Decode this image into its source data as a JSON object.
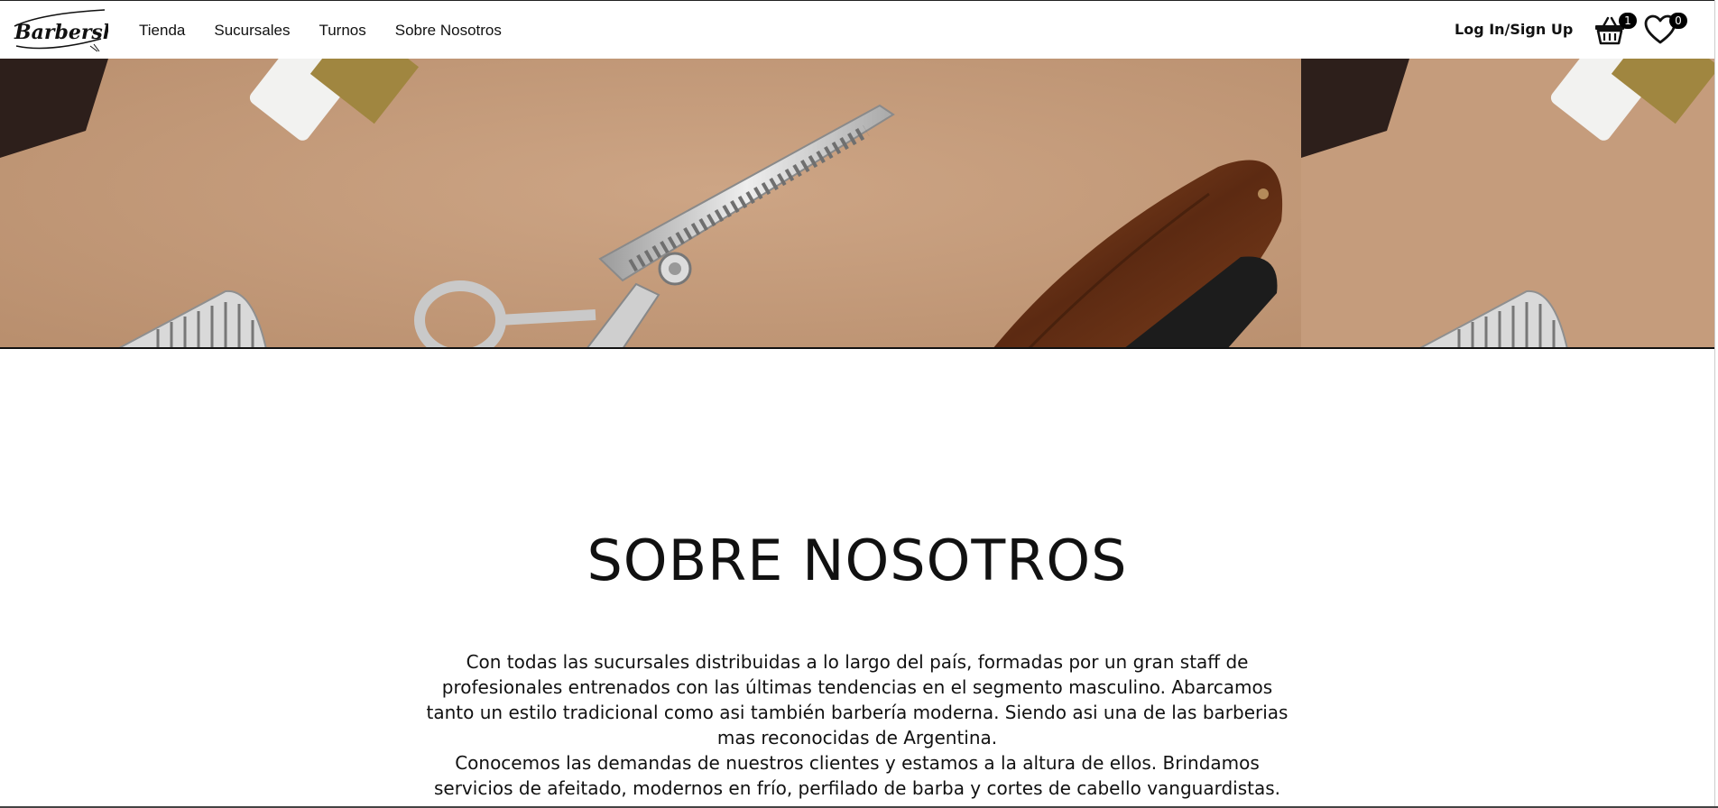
{
  "brand": {
    "logo_text": "Barbershop"
  },
  "nav": {
    "links": [
      {
        "label": "Tienda"
      },
      {
        "label": "Sucursales"
      },
      {
        "label": "Turnos"
      },
      {
        "label": "Sobre Nosotros"
      }
    ],
    "login_label": "Log In/Sign Up",
    "cart": {
      "icon": "basket-icon",
      "count": "1"
    },
    "favorites": {
      "icon": "heart-icon",
      "count": "0"
    }
  },
  "hero": {
    "background_color": "#c9a07f",
    "description_icons": [
      "scissors-icon",
      "razor-icon",
      "comb-icon",
      "bottle-icon"
    ]
  },
  "about": {
    "title": "SOBRE NOSOTROS",
    "paragraphs": [
      "Con todas las sucursales distribuidas a lo largo del país, formadas por un gran staff de profesionales entrenados con las últimas tendencias en el segmento masculino. Abarcamos tanto un estilo tradicional como asi también barbería moderna. Siendo asi una de las barberias mas reconocidas de Argentina.",
      "Conocemos las demandas de nuestros clientes y estamos a la altura de ellos. Brindamos servicios de afeitado, modernos en frío, perfilado de barba y cortes de cabello vanguardistas."
    ]
  }
}
